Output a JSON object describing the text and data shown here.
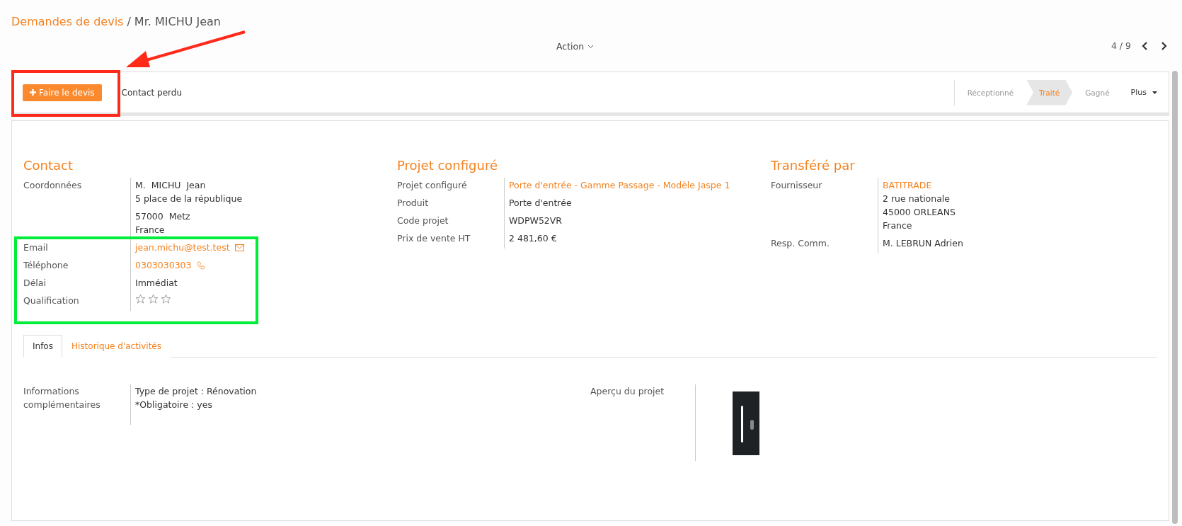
{
  "breadcrumb": {
    "parent": "Demandes de devis",
    "separator": "/",
    "current": "Mr. MICHU Jean"
  },
  "action_menu": {
    "label": "Action"
  },
  "pager": {
    "counter": "4 / 9"
  },
  "toolbar": {
    "buttons": [
      {
        "label": "Faire le devis",
        "kind": "primary"
      },
      {
        "label": "Contact perdu",
        "kind": "secondary"
      }
    ],
    "stages": [
      {
        "label": "Réceptionné",
        "selected": false
      },
      {
        "label": "Traité",
        "selected": true
      },
      {
        "label": "Gagné",
        "selected": false
      }
    ],
    "more": "Plus"
  },
  "sections": [
    {
      "title": "Contact",
      "fields": [
        {
          "label": "Coordonnées",
          "kind": "text",
          "blocks": [
            [
              "M.  MICHU  Jean",
              "5 place de la république"
            ],
            [
              "57000  Metz",
              "France"
            ]
          ]
        },
        {
          "label": "Email",
          "kind": "email",
          "value": "jean.michu@test.test"
        },
        {
          "label": "Téléphone",
          "kind": "phone",
          "value": "0303030303"
        },
        {
          "label": "Délai",
          "kind": "text",
          "blocks": [
            [
              "Immédiat"
            ]
          ]
        },
        {
          "label": "Qualification",
          "kind": "stars",
          "stars": 0
        }
      ]
    },
    {
      "title": "Projet configuré",
      "fields": [
        {
          "label": "Projet configuré",
          "kind": "link",
          "value": "Porte d'entrée - Gamme Passage - Modèle Jaspe 1"
        },
        {
          "label": "Produit",
          "kind": "text",
          "blocks": [
            [
              "Porte d'entrée"
            ]
          ]
        },
        {
          "label": "Code projet",
          "kind": "text",
          "blocks": [
            [
              "WDPW52VR"
            ]
          ]
        },
        {
          "label": "Prix de vente HT",
          "kind": "text",
          "blocks": [
            [
              "2 481,60 €"
            ]
          ]
        }
      ]
    },
    {
      "title": "Transféré par",
      "fields": [
        {
          "label": "Fournisseur",
          "kind": "link",
          "value": "BATITRADE",
          "blocks": [
            [
              "2 rue nationale",
              "45000 ORLEANS",
              "France"
            ]
          ]
        },
        {
          "label": "Resp. Comm.",
          "kind": "text",
          "blocks": [
            [
              "M. LEBRUN Adrien"
            ]
          ]
        }
      ]
    }
  ],
  "tabs": [
    {
      "label": "Infos",
      "selected": true
    },
    {
      "label": "Historique d'activités",
      "selected": false
    }
  ],
  "info": {
    "label": "Informations complémentaires",
    "lines": [
      "Type de projet : Rénovation",
      "*Obligatoire : yes"
    ],
    "preview_label": "Aperçu du projet"
  },
  "annotations": [
    {
      "kind": "frame",
      "color": "#ff2a1a"
    },
    {
      "kind": "arrow",
      "color": "#ff2a1a"
    },
    {
      "kind": "frame",
      "color": "#00ee3a"
    }
  ]
}
